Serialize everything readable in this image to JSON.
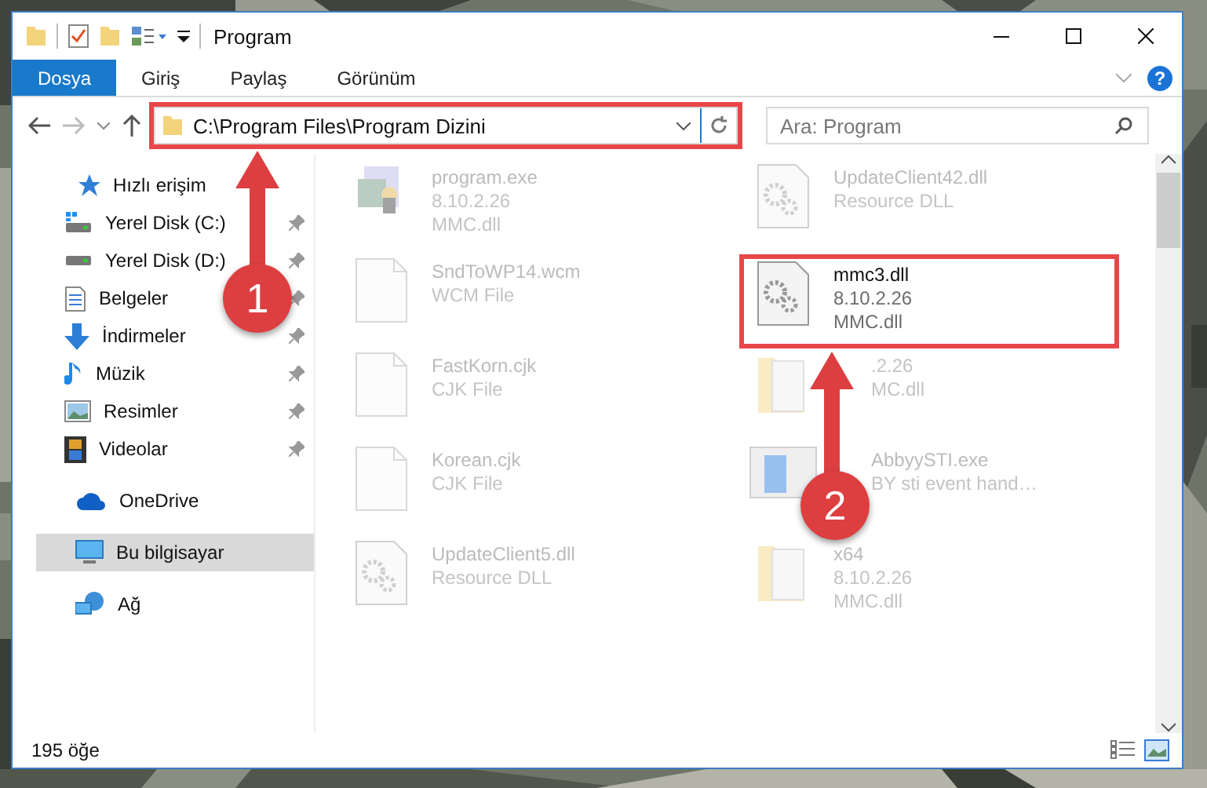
{
  "window": {
    "title": "Program"
  },
  "ribbon_tabs": [
    {
      "label": "Dosya",
      "selected": true
    },
    {
      "label": "Giriş",
      "selected": false
    },
    {
      "label": "Paylaş",
      "selected": false
    },
    {
      "label": "Görünüm",
      "selected": false
    }
  ],
  "help": "?",
  "address": {
    "value": "C:\\Program Files\\Program Dizini",
    "highlighted": true
  },
  "search": {
    "placeholder": "Ara: Program"
  },
  "sidebar": {
    "items": [
      {
        "label": "Hızlı erişim",
        "selected": false,
        "children": [
          {
            "label": "Yerel Disk (C:)",
            "pinned": true,
            "selected": false
          },
          {
            "label": "Yerel Disk (D:)",
            "pinned": true,
            "selected": false
          },
          {
            "label": "Belgeler",
            "pinned": true,
            "selected": false
          },
          {
            "label": "İndirmeler",
            "pinned": true,
            "selected": false
          },
          {
            "label": "Müzik",
            "pinned": true,
            "selected": false
          },
          {
            "label": "Resimler",
            "pinned": true,
            "selected": false
          },
          {
            "label": "Videolar",
            "pinned": true,
            "selected": false
          }
        ]
      },
      {
        "label": "OneDrive",
        "selected": false
      },
      {
        "label": "Bu bilgisayar",
        "selected": true
      },
      {
        "label": "Ağ",
        "selected": false
      }
    ]
  },
  "files": [
    {
      "kind": "exe",
      "name": "program.exe",
      "lines": [
        "8.10.2.26",
        "MMC.dll"
      ],
      "highlighted": false
    },
    {
      "kind": "dll",
      "name": "UpdateClient42.dll",
      "lines": [
        "Resource DLL"
      ],
      "highlighted": false
    },
    {
      "kind": "file",
      "name": "SndToWP14.wcm",
      "lines": [
        "WCM File"
      ],
      "highlighted": false
    },
    {
      "kind": "dll",
      "name": "mmc3.dll",
      "lines": [
        "8.10.2.26",
        "MMC.dll"
      ],
      "highlighted": true
    },
    {
      "kind": "file",
      "name": "FastKorn.cjk",
      "lines": [
        "CJK File"
      ],
      "highlighted": false
    },
    {
      "kind": "folder",
      "lines": [
        ".2.26",
        "MC.dll"
      ],
      "highlighted": false,
      "covered": true
    },
    {
      "kind": "file",
      "name": "Korean.cjk",
      "lines": [
        "CJK File"
      ],
      "highlighted": false
    },
    {
      "kind": "app",
      "name": "AbbyySTI.exe",
      "lines": [
        "BY sti event hand…"
      ],
      "highlighted": false,
      "covered": true
    },
    {
      "kind": "dll",
      "name": "UpdateClient5.dll",
      "lines": [
        "Resource DLL"
      ],
      "highlighted": false
    },
    {
      "kind": "folder",
      "name": "x64",
      "lines": [
        "8.10.2.26",
        "MMC.dll"
      ],
      "highlighted": false
    }
  ],
  "status_bar": {
    "count": "195 öğe"
  },
  "annotations": [
    {
      "label": "1"
    },
    {
      "label": "2"
    }
  ]
}
